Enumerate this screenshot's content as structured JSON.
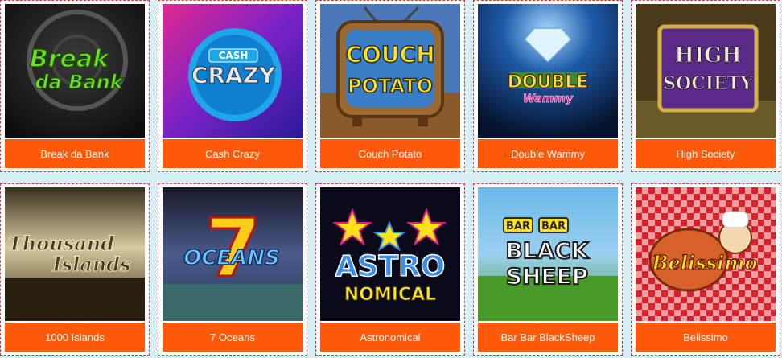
{
  "games": [
    {
      "title": "Break da Bank",
      "logo": [
        "Break",
        "da Bank"
      ]
    },
    {
      "title": "Cash Crazy",
      "logo": [
        "CASH",
        "CRAZY"
      ]
    },
    {
      "title": "Couch Potato",
      "logo": [
        "COUCH",
        "POTATO"
      ]
    },
    {
      "title": "Double Wammy",
      "logo": [
        "DOUBLE",
        "Wammy"
      ]
    },
    {
      "title": "High Society",
      "logo": [
        "HIGH",
        "SOCIETY"
      ]
    },
    {
      "title": "1000 Islands",
      "logo": [
        "Thousand",
        "Islands"
      ]
    },
    {
      "title": "7 Oceans",
      "logo": [
        "7",
        "OCEANS"
      ]
    },
    {
      "title": "Astronomical",
      "logo": [
        "ASTRO",
        "NOMICAL"
      ]
    },
    {
      "title": "Bar Bar BlackSheep",
      "logo": [
        "BAR",
        "BAR",
        "BLACK",
        "SHEEP"
      ]
    },
    {
      "title": "Belissimo",
      "logo": [
        "Belissimo"
      ]
    }
  ],
  "colors": {
    "label_bg": "#ff5a0a",
    "label_text": "#ffffff",
    "tile_border": "#d23a3a",
    "page_bg": "#d6eef4"
  }
}
